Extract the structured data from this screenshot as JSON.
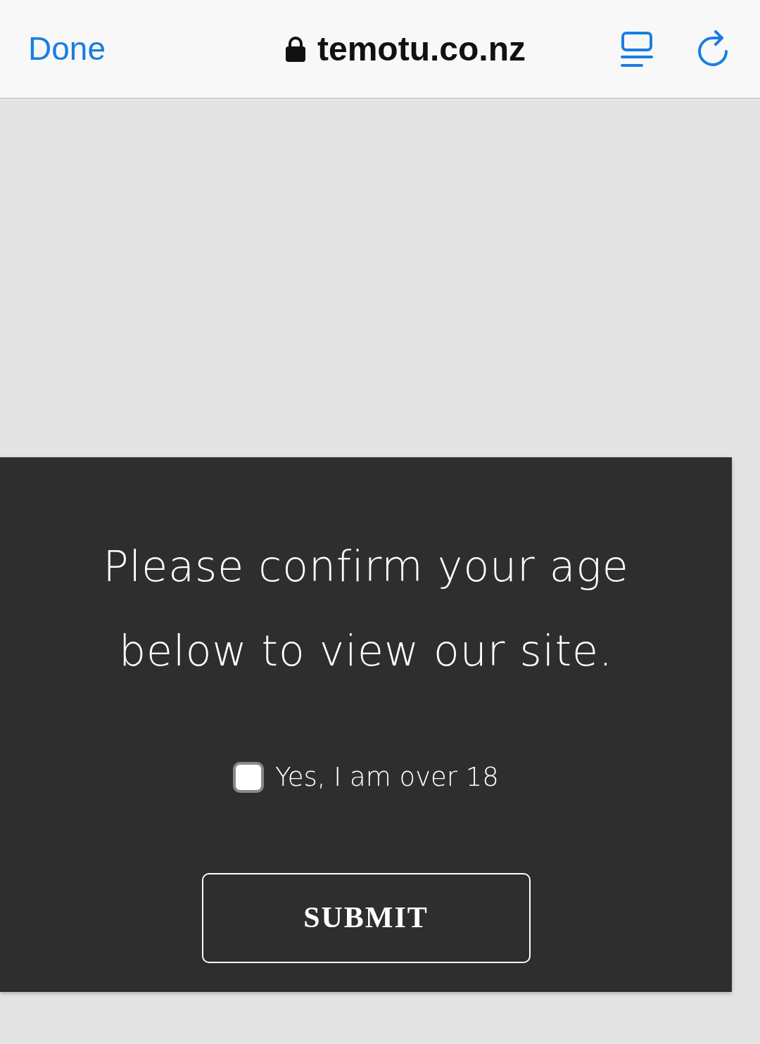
{
  "browser_bar": {
    "done_label": "Done",
    "address": "temotu.co.nz",
    "secure": true
  },
  "age_gate": {
    "message": "Please confirm your age below to view our site.",
    "checkbox": {
      "label": "Yes, I am over 18",
      "checked": false
    },
    "submit_label": "SUBMIT"
  }
}
